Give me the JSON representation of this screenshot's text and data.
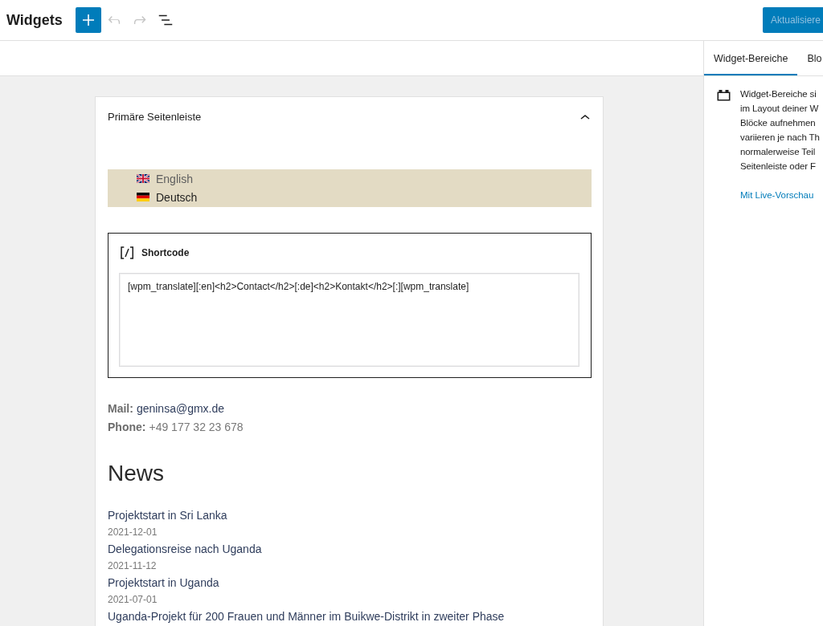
{
  "header": {
    "title": "Widgets",
    "undo": {
      "disabled": true
    },
    "redo": {
      "disabled": true
    },
    "update_button": {
      "label": "Aktualisiere",
      "disabled": true
    }
  },
  "widget_area": {
    "title": "Primäre Seitenleiste",
    "expanded": true,
    "languages": [
      {
        "label": "English",
        "kind": "british",
        "selected": false
      },
      {
        "label": "Deutsch",
        "kind": "german",
        "selected": true
      }
    ],
    "shortcode": {
      "label": "Shortcode",
      "value": "[wpm_translate][:en]<h2>Contact</h2>[:de]<h2>Kontakt</h2>[:][wpm_translate]"
    },
    "contact": {
      "mail_label": "Mail:",
      "mail": "geninsa@gmx.de",
      "phone_label": "Phone:",
      "phone": "+49 177 32 23 678"
    },
    "news_heading": "News",
    "news": [
      {
        "title": "Projektstart in Sri Lanka",
        "date": "2021-12-01"
      },
      {
        "title": "Delegationsreise nach Uganda",
        "date": "2021-11-12"
      },
      {
        "title": "Projektstart in Uganda",
        "date": "2021-07-01"
      },
      {
        "title": "Uganda-Projekt für 200 Frauen und Männer im Buikwe-Distrikt in zweiter Phase"
      }
    ]
  },
  "sidebar": {
    "tabs": [
      {
        "label": "Widget-Bereiche",
        "selected": true
      },
      {
        "label": "Blo",
        "selected": false
      }
    ],
    "description_lines": [
      "Widget-Bereiche si",
      "im Layout deiner W",
      "Blöcke aufnehmen",
      "variieren je nach Th",
      "normalerweise Teil",
      "Seitenleiste oder F"
    ],
    "link": "Mit Live-Vorschau"
  }
}
